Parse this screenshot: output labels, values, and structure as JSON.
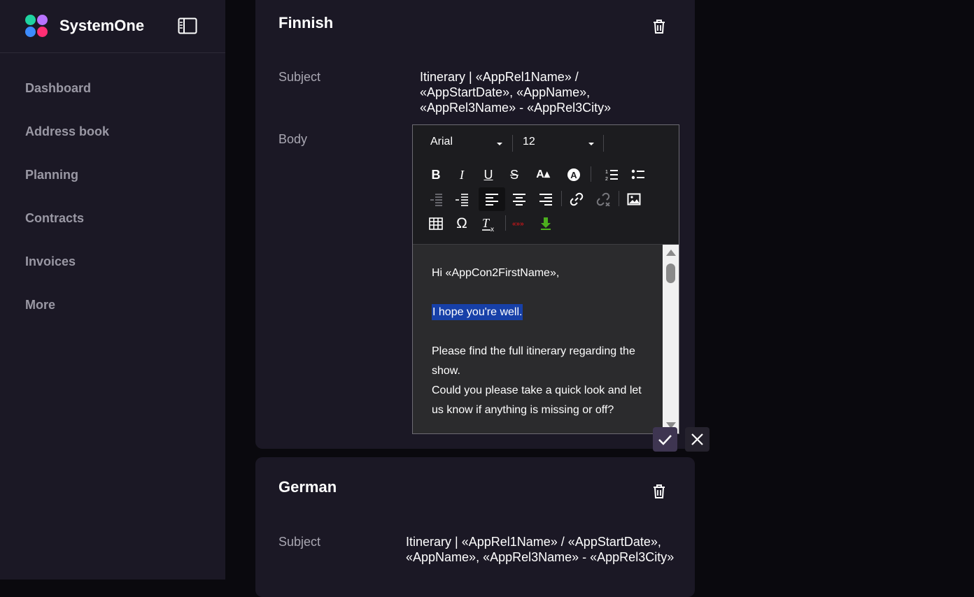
{
  "app": {
    "name": "SystemOne"
  },
  "sidebar": {
    "items": [
      {
        "label": "Dashboard"
      },
      {
        "label": "Address book"
      },
      {
        "label": "Planning"
      },
      {
        "label": "Contracts"
      },
      {
        "label": "Invoices"
      },
      {
        "label": "More"
      }
    ]
  },
  "templates": [
    {
      "language": "Finnish",
      "subject_label": "Subject",
      "subject": "Itinerary | «AppRel1Name» / «AppStartDate», «AppName», «AppRel3Name» - «AppRel3City»",
      "body_label": "Body",
      "editor": {
        "font": "Arial",
        "size": "12",
        "body_lines": [
          "Hi «AppCon2FirstName»,",
          "I hope you're well.",
          "Please find the full itinerary regarding the show.",
          "Could you please take a quick look and let us know if anything is missing or off?"
        ]
      }
    },
    {
      "language": "German",
      "subject_label": "Subject",
      "subject": "Itinerary | «AppRel1Name» / «AppStartDate», «AppName», «AppRel3Name» - «AppRel3City»"
    }
  ],
  "icons": {
    "logo": "systemone-logo",
    "panel": "sidebar-toggle-icon",
    "trash": "trash-icon",
    "confirm": "check-icon",
    "cancel": "close-icon"
  },
  "colors": {
    "sidebar_bg": "#1b1825",
    "card_bg": "#1b1825",
    "highlight": "#1740a8",
    "confirm_bg": "#3e3551"
  }
}
